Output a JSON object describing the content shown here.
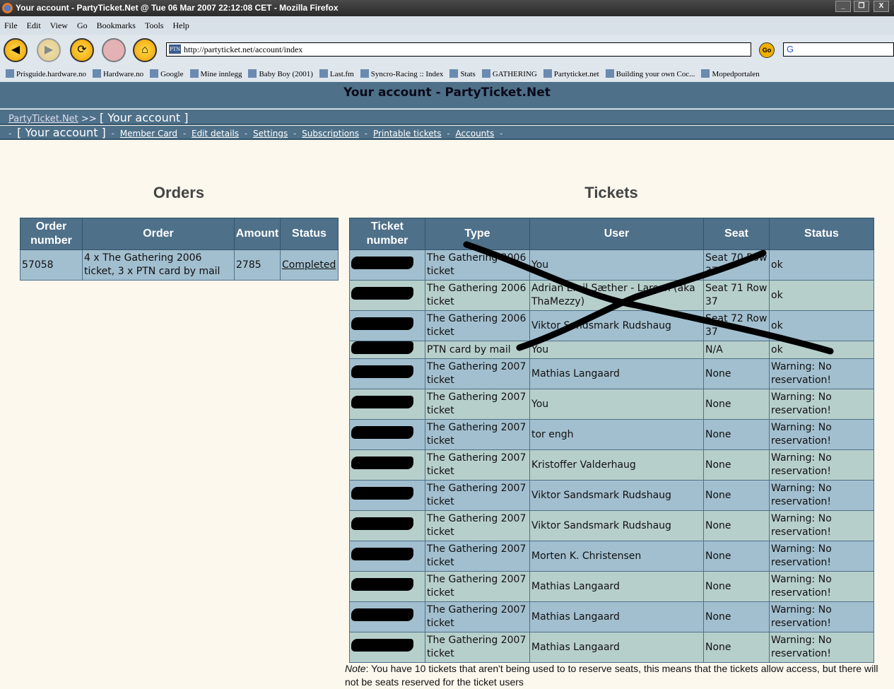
{
  "window": {
    "title": "Your account - PartyTicket.Net @ Tue 06 Mar 2007 22:12:08 CET - Mozilla Firefox"
  },
  "menu": [
    "File",
    "Edit",
    "View",
    "Go",
    "Bookmarks",
    "Tools",
    "Help"
  ],
  "address": {
    "url": "http://partyticket.net/account/index",
    "go_label": "Go",
    "search_engine": "G"
  },
  "bookmarks": [
    "Prisguide.hardware.no",
    "Hardware.no",
    "Google",
    "Mine innlegg",
    "Baby Boy (2001)",
    "Last.fm",
    "Syncro-Racing :: Index",
    "Stats",
    "GATHERING",
    "Partyticket.net",
    "Building your own Coc...",
    "Mopedportalen"
  ],
  "page": {
    "title": "Your account - PartyTicket.Net",
    "breadcrumb": {
      "home": "PartyTicket.Net",
      "sep": ">>",
      "current": "[ Your account ]"
    },
    "subnav": {
      "current": "[ Your account ]",
      "links": [
        "Member Card",
        "Edit details",
        "Settings",
        "Subscriptions",
        "Printable tickets",
        "Accounts"
      ]
    }
  },
  "orders": {
    "heading": "Orders",
    "columns": [
      "Order number",
      "Order",
      "Amount",
      "Status"
    ],
    "rows": [
      {
        "number": "57058",
        "order": "4 x The Gathering 2006 ticket, 3 x PTN card by mail",
        "amount": "2785",
        "status": "Completed"
      }
    ]
  },
  "tickets": {
    "heading": "Tickets",
    "columns": [
      "Ticket number",
      "Type",
      "User",
      "Seat",
      "Status"
    ],
    "rows": [
      {
        "type": "The Gathering 2006 ticket",
        "user": "You",
        "seat": "Seat 70 Row 37",
        "status": "ok"
      },
      {
        "type": "The Gathering 2006 ticket",
        "user": "Adrian Emil Sæther - Larsen (aka ThaMezzy)",
        "seat": "Seat 71 Row 37",
        "status": "ok"
      },
      {
        "type": "The Gathering 2006 ticket",
        "user": "Viktor Sandsmark Rudshaug",
        "seat": "Seat 72 Row 37",
        "status": "ok"
      },
      {
        "type": "PTN card by mail",
        "user": "You",
        "seat": "N/A",
        "status": "ok"
      },
      {
        "type": "The Gathering 2007 ticket",
        "user": "Mathias Langaard",
        "seat": "None",
        "status": "Warning: No reservation!"
      },
      {
        "type": "The Gathering 2007 ticket",
        "user": "You",
        "seat": "None",
        "status": "Warning: No reservation!"
      },
      {
        "type": "The Gathering 2007 ticket",
        "user": "tor engh",
        "seat": "None",
        "status": "Warning: No reservation!"
      },
      {
        "type": "The Gathering 2007 ticket",
        "user": "Kristoffer Valderhaug",
        "seat": "None",
        "status": "Warning: No reservation!"
      },
      {
        "type": "The Gathering 2007 ticket",
        "user": "Viktor Sandsmark Rudshaug",
        "seat": "None",
        "status": "Warning: No reservation!"
      },
      {
        "type": "The Gathering 2007 ticket",
        "user": "Viktor Sandsmark Rudshaug",
        "seat": "None",
        "status": "Warning: No reservation!"
      },
      {
        "type": "The Gathering 2007 ticket",
        "user": "Morten K. Christensen",
        "seat": "None",
        "status": "Warning: No reservation!"
      },
      {
        "type": "The Gathering 2007 ticket",
        "user": "Mathias Langaard",
        "seat": "None",
        "status": "Warning: No reservation!"
      },
      {
        "type": "The Gathering 2007 ticket",
        "user": "Mathias Langaard",
        "seat": "None",
        "status": "Warning: No reservation!"
      },
      {
        "type": "The Gathering 2007 ticket",
        "user": "Mathias Langaard",
        "seat": "None",
        "status": "Warning: No reservation!"
      }
    ]
  },
  "note": {
    "label": "Note",
    "text": ": You have 10 tickets that aren't being used to to reserve seats, this means that the tickets allow access, but there will not be seats reserved for the ticket users"
  }
}
